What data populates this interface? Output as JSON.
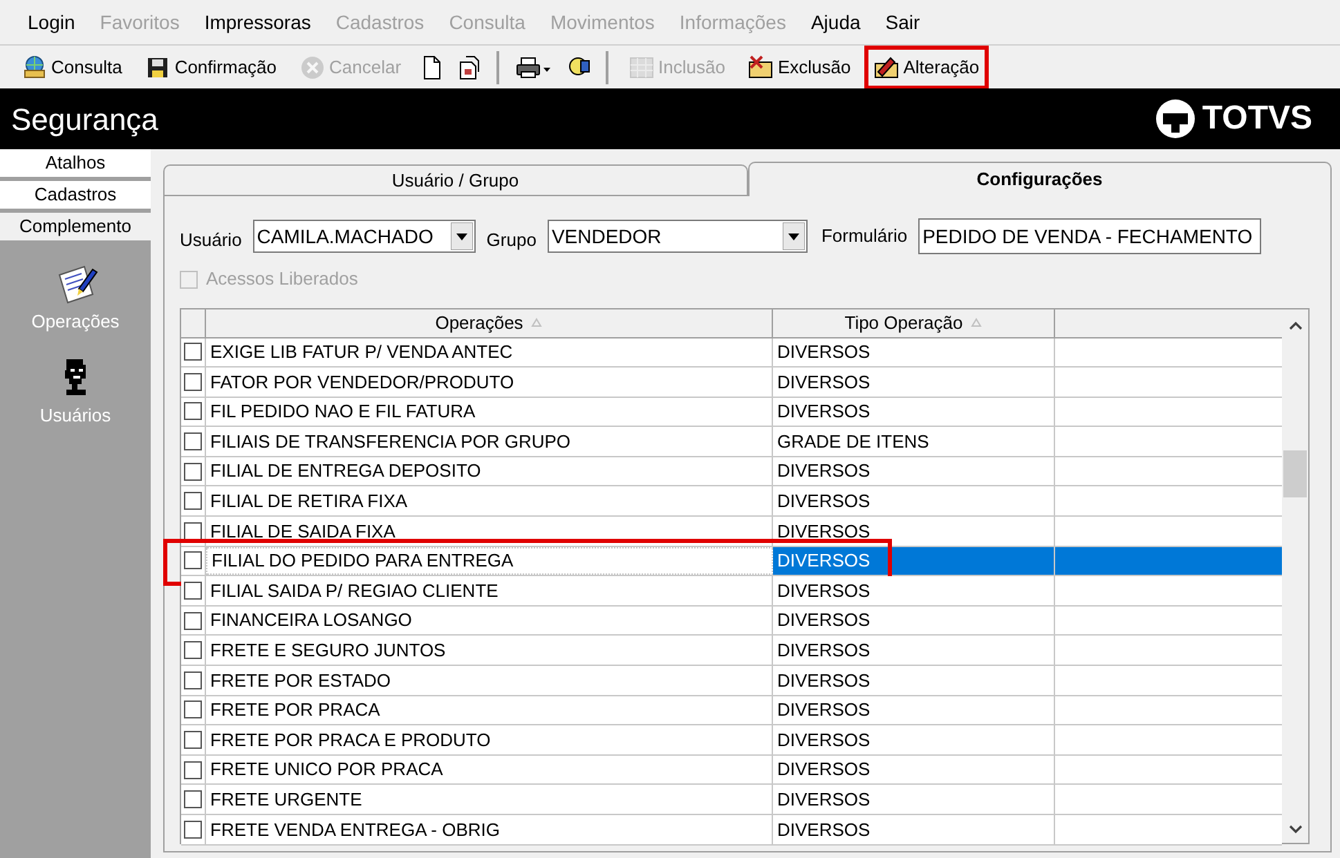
{
  "menu": [
    {
      "label": "Login",
      "disabled": false
    },
    {
      "label": "Favoritos",
      "disabled": true
    },
    {
      "label": "Impressoras",
      "disabled": false
    },
    {
      "label": "Cadastros",
      "disabled": true
    },
    {
      "label": "Consulta",
      "disabled": true
    },
    {
      "label": "Movimentos",
      "disabled": true
    },
    {
      "label": "Informações",
      "disabled": true
    },
    {
      "label": "Ajuda",
      "disabled": false
    },
    {
      "label": "Sair",
      "disabled": false
    }
  ],
  "toolbar": [
    {
      "kind": "button",
      "label": "Consulta",
      "disabled": false,
      "highlighted": false
    },
    {
      "kind": "button",
      "label": "Confirmação",
      "disabled": false,
      "highlighted": false
    },
    {
      "kind": "button",
      "label": "Cancelar",
      "disabled": true,
      "highlighted": false
    },
    {
      "kind": "icon",
      "disabled": false
    },
    {
      "kind": "icon",
      "disabled": false
    },
    {
      "kind": "separator"
    },
    {
      "kind": "icon",
      "disabled": false
    },
    {
      "kind": "icon",
      "disabled": false
    },
    {
      "kind": "separator"
    },
    {
      "kind": "button",
      "label": "Inclusão",
      "disabled": true,
      "highlighted": false
    },
    {
      "kind": "button",
      "label": "Exclusão",
      "disabled": false,
      "highlighted": false
    },
    {
      "kind": "button",
      "label": "Alteração",
      "disabled": false,
      "highlighted": true
    }
  ],
  "header": {
    "title": "Segurança",
    "logo": "TOTVS"
  },
  "sidebar": {
    "tabs": [
      {
        "label": "Atalhos",
        "selected": false
      },
      {
        "label": "Cadastros",
        "selected": false
      },
      {
        "label": "Complemento",
        "selected": true
      }
    ],
    "items": [
      {
        "label": "Operações"
      },
      {
        "label": "Usuários"
      }
    ]
  },
  "tabs": [
    {
      "label": "Usuário  / Grupo",
      "selected": false
    },
    {
      "label": "Configurações",
      "selected": true
    }
  ],
  "form": {
    "user_label": "Usuário",
    "user": "CAMILA.MACHADO",
    "group_label": "Grupo",
    "group": "VENDEDOR",
    "form_label": "Formulário",
    "form": "PEDIDO DE VENDA - FECHAMENTO",
    "access_label": "Acessos Liberados",
    "access_checked": false,
    "access_disabled": true
  },
  "table": {
    "columns": [
      "Operações",
      "Tipo Operação"
    ],
    "rows": [
      {
        "operation": "EXIGE LIB FATUR P/ VENDA ANTEC",
        "type": "DIVERSOS",
        "checked": false,
        "selected": false,
        "highlighted": false
      },
      {
        "operation": "FATOR POR VENDEDOR/PRODUTO",
        "type": "DIVERSOS",
        "checked": false,
        "selected": false,
        "highlighted": false
      },
      {
        "operation": "FIL PEDIDO NAO E FIL FATURA",
        "type": "DIVERSOS",
        "checked": false,
        "selected": false,
        "highlighted": false
      },
      {
        "operation": "FILIAIS DE TRANSFERENCIA POR GRUPO",
        "type": "GRADE DE ITENS",
        "checked": false,
        "selected": false,
        "highlighted": false
      },
      {
        "operation": "FILIAL DE ENTREGA DEPOSITO",
        "type": "DIVERSOS",
        "checked": false,
        "selected": false,
        "highlighted": false
      },
      {
        "operation": "FILIAL DE RETIRA FIXA",
        "type": "DIVERSOS",
        "checked": false,
        "selected": false,
        "highlighted": false
      },
      {
        "operation": "FILIAL DE SAIDA FIXA",
        "type": "DIVERSOS",
        "checked": false,
        "selected": false,
        "highlighted": false
      },
      {
        "operation": "FILIAL DO PEDIDO PARA ENTREGA",
        "type": "DIVERSOS",
        "checked": false,
        "selected": true,
        "highlighted": true
      },
      {
        "operation": "FILIAL SAIDA P/ REGIAO CLIENTE",
        "type": "DIVERSOS",
        "checked": false,
        "selected": false,
        "highlighted": false
      },
      {
        "operation": "FINANCEIRA LOSANGO",
        "type": "DIVERSOS",
        "checked": false,
        "selected": false,
        "highlighted": false
      },
      {
        "operation": "FRETE E SEGURO JUNTOS",
        "type": "DIVERSOS",
        "checked": false,
        "selected": false,
        "highlighted": false
      },
      {
        "operation": "FRETE POR ESTADO",
        "type": "DIVERSOS",
        "checked": false,
        "selected": false,
        "highlighted": false
      },
      {
        "operation": "FRETE POR PRACA",
        "type": "DIVERSOS",
        "checked": false,
        "selected": false,
        "highlighted": false
      },
      {
        "operation": "FRETE POR PRACA E PRODUTO",
        "type": "DIVERSOS",
        "checked": false,
        "selected": false,
        "highlighted": false
      },
      {
        "operation": "FRETE UNICO POR PRACA",
        "type": "DIVERSOS",
        "checked": false,
        "selected": false,
        "highlighted": false
      },
      {
        "operation": "FRETE URGENTE",
        "type": "DIVERSOS",
        "checked": false,
        "selected": false,
        "highlighted": false
      },
      {
        "operation": "FRETE VENDA ENTREGA - OBRIG",
        "type": "DIVERSOS",
        "checked": false,
        "selected": false,
        "highlighted": false
      }
    ]
  }
}
